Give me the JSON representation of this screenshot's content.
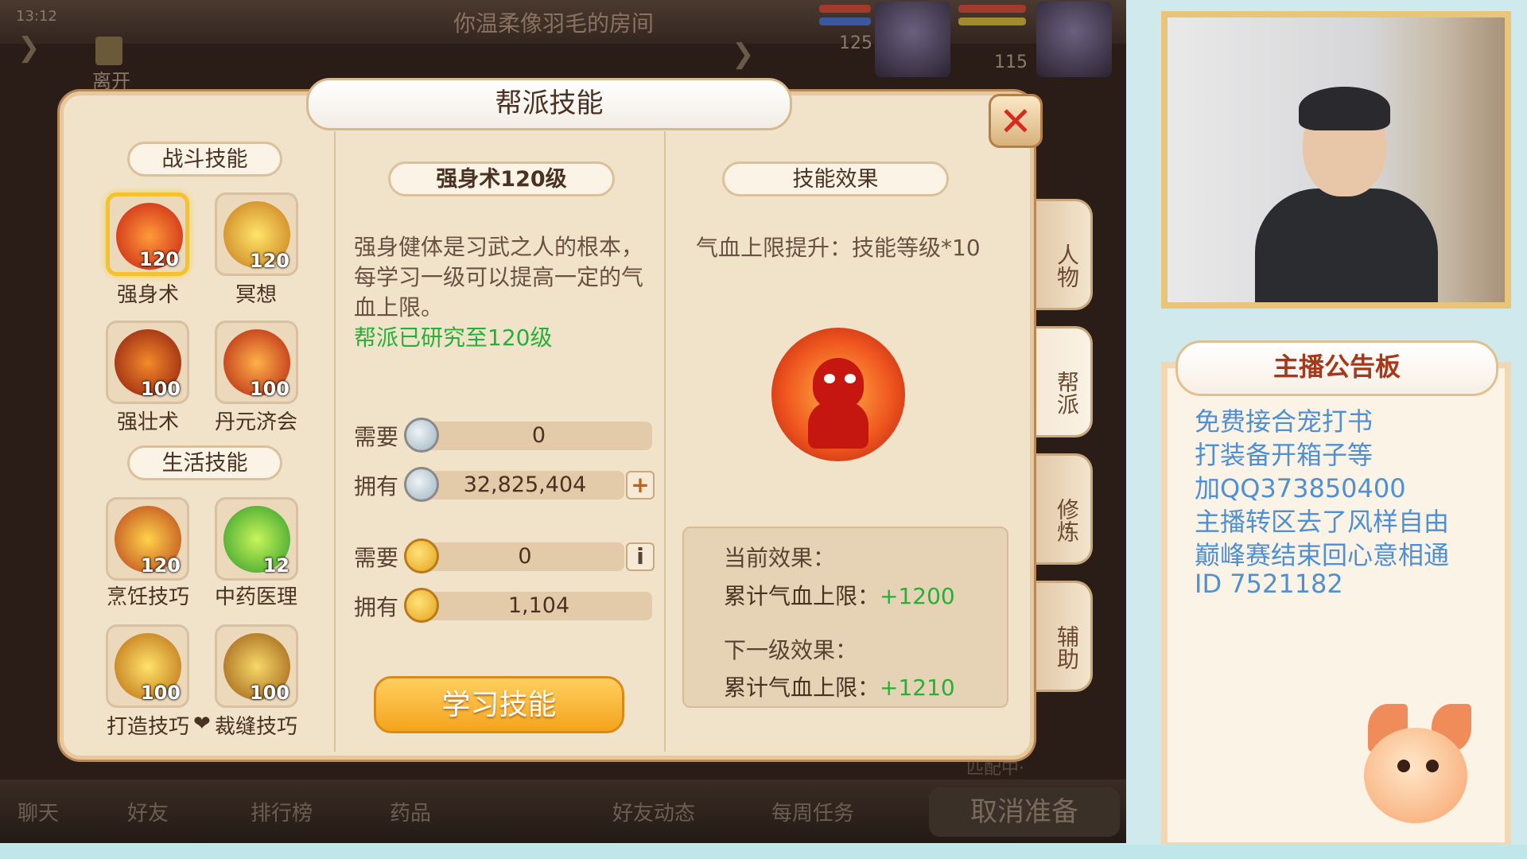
{
  "game": {
    "time": "13:12",
    "room_title": "你温柔像羽毛的房间",
    "leave_label": "离开",
    "player_levels": [
      "125",
      "115"
    ],
    "bottom_bar": [
      "聊天",
      "好友",
      "排行榜",
      "药品",
      "好友动态",
      "每周任务"
    ],
    "cancel_label": "取消准备",
    "matching_text": "匹配中·"
  },
  "panel": {
    "title": "帮派技能",
    "close_icon": "close-icon",
    "combat_tag": "战斗技能",
    "life_tag": "生活技能",
    "combat_skills": [
      {
        "name": "强身术",
        "level": "120",
        "icon": "flame-warrior-icon"
      },
      {
        "name": "冥想",
        "level": "120",
        "icon": "meditation-icon"
      },
      {
        "name": "强壮术",
        "level": "100",
        "icon": "strength-icon"
      },
      {
        "name": "丹元济会",
        "level": "100",
        "icon": "elixir-icon"
      }
    ],
    "life_skills": [
      {
        "name": "烹饪技巧",
        "level": "120",
        "icon": "cooking-icon"
      },
      {
        "name": "中药医理",
        "level": "12",
        "icon": "herb-leaf-icon"
      },
      {
        "name": "打造技巧",
        "level": "100",
        "icon": "forging-icon"
      },
      {
        "name": "裁缝技巧",
        "level": "100",
        "icon": "tailoring-icon"
      }
    ],
    "detail": {
      "skill_tag": "强身术120级",
      "desc": "强身健体是习武之人的根本，每学习一级可以提高一定的气血上限。",
      "research": "帮派已研究至120级",
      "need_label": "需要",
      "own_label": "拥有",
      "silver_need": "0",
      "silver_own": "32,825,404",
      "gold_need": "0",
      "gold_own": "1,104",
      "add_label": "+",
      "info_label": "i",
      "learn_label": "学习技能"
    },
    "effect": {
      "tag": "技能效果",
      "formula": "气血上限提升：技能等级*10",
      "current_title": "当前效果：",
      "current_label": "累计气血上限：",
      "current_value": "+1200",
      "next_title": "下一级效果：",
      "next_label": "累计气血上限：",
      "next_value": "+1210"
    },
    "side_tabs": [
      "人物",
      "帮派",
      "修炼",
      "辅助"
    ]
  },
  "board": {
    "title": "主播公告板",
    "lines": [
      "免费接合宠打书",
      "打装备开箱子等",
      "加QQ373850400",
      "主播转区去了风样自由",
      "巅峰赛结束回心意相通",
      "ID 7521182"
    ]
  },
  "colors": {
    "accent_gold": "#f4a41c",
    "plus_green": "#25b137",
    "board_text": "#4f8fd4",
    "close_red": "#d52a1f"
  }
}
